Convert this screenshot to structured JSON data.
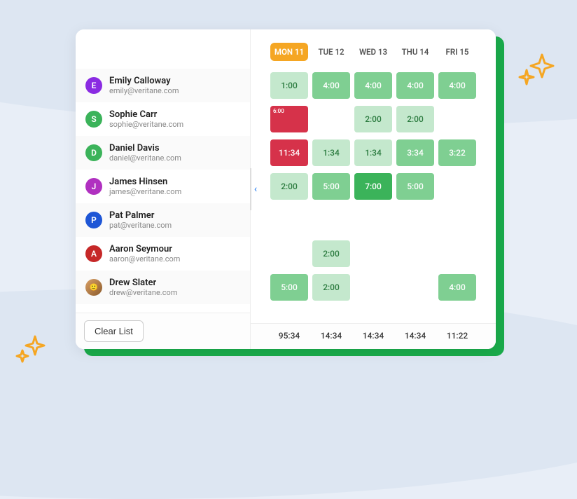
{
  "days": [
    {
      "label": "MON 11",
      "active": true
    },
    {
      "label": "TUE 12",
      "active": false
    },
    {
      "label": "WED 13",
      "active": false
    },
    {
      "label": "THU 14",
      "active": false
    },
    {
      "label": "FRI 15",
      "active": false
    }
  ],
  "people": [
    {
      "initial": "E",
      "name": "Emily Calloway",
      "email": "emily@veritane.com",
      "color": "#8a2be2",
      "cells": [
        {
          "v": "1:00",
          "s": "light"
        },
        {
          "v": "4:00",
          "s": "mid"
        },
        {
          "v": "4:00",
          "s": "mid"
        },
        {
          "v": "4:00",
          "s": "mid"
        },
        {
          "v": "4:00",
          "s": "mid"
        }
      ]
    },
    {
      "initial": "S",
      "name": "Sophie Carr",
      "email": "sophie@veritane.com",
      "color": "#3bb35a",
      "cells": [
        {
          "v": "6:00",
          "s": "redsmall"
        },
        {
          "v": "",
          "s": "empty"
        },
        {
          "v": "2:00",
          "s": "light"
        },
        {
          "v": "2:00",
          "s": "light"
        },
        {
          "v": "",
          "s": "empty"
        }
      ]
    },
    {
      "initial": "D",
      "name": "Daniel Davis",
      "email": "daniel@veritane.com",
      "color": "#3bb35a",
      "cells": [
        {
          "v": "11:34",
          "s": "red"
        },
        {
          "v": "1:34",
          "s": "light"
        },
        {
          "v": "1:34",
          "s": "light"
        },
        {
          "v": "3:34",
          "s": "mid"
        },
        {
          "v": "3:22",
          "s": "mid"
        }
      ]
    },
    {
      "initial": "J",
      "name": "James Hinsen",
      "email": "james@veritane.com",
      "color": "#b030c0",
      "cells": [
        {
          "v": "2:00",
          "s": "light"
        },
        {
          "v": "5:00",
          "s": "mid"
        },
        {
          "v": "7:00",
          "s": "dark"
        },
        {
          "v": "5:00",
          "s": "mid"
        },
        {
          "v": "",
          "s": "empty"
        }
      ]
    },
    {
      "initial": "P",
      "name": "Pat Palmer",
      "email": "pat@veritane.com",
      "color": "#1e56d6",
      "cells": [
        {
          "v": "",
          "s": "empty"
        },
        {
          "v": "",
          "s": "empty"
        },
        {
          "v": "",
          "s": "empty"
        },
        {
          "v": "",
          "s": "empty"
        },
        {
          "v": "",
          "s": "empty"
        }
      ]
    },
    {
      "initial": "A",
      "name": "Aaron Seymour",
      "email": "aaron@veritane.com",
      "color": "#c62828",
      "cells": [
        {
          "v": "",
          "s": "empty"
        },
        {
          "v": "2:00",
          "s": "light"
        },
        {
          "v": "",
          "s": "empty"
        },
        {
          "v": "",
          "s": "empty"
        },
        {
          "v": "",
          "s": "empty"
        }
      ]
    },
    {
      "initial": "🙂",
      "photo": true,
      "name": "Drew Slater",
      "email": "drew@veritane.com",
      "color": "#555",
      "cells": [
        {
          "v": "5:00",
          "s": "mid"
        },
        {
          "v": "2:00",
          "s": "light"
        },
        {
          "v": "",
          "s": "empty"
        },
        {
          "v": "",
          "s": "empty"
        },
        {
          "v": "4:00",
          "s": "mid"
        }
      ]
    }
  ],
  "totals": [
    "95:34",
    "14:34",
    "14:34",
    "14:34",
    "11:22"
  ],
  "buttons": {
    "clear": "Clear List"
  },
  "icons": {
    "collapse": "‹"
  }
}
